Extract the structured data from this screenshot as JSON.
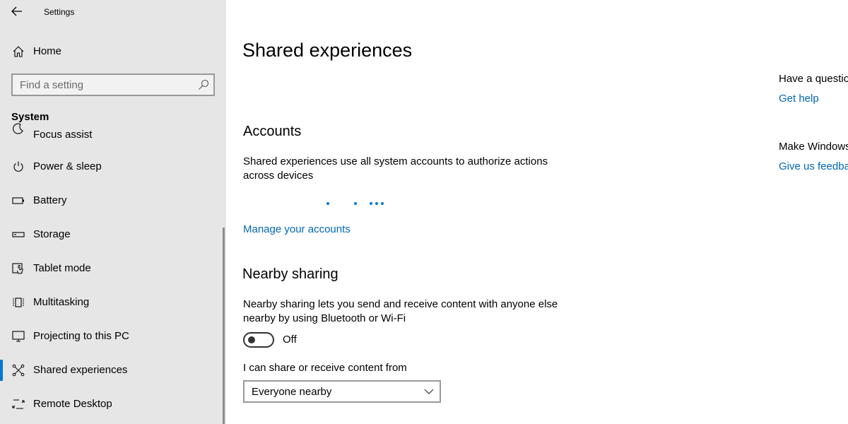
{
  "window": {
    "title": "Settings"
  },
  "sidebar": {
    "home_label": "Home",
    "search": {
      "placeholder": "Find a setting",
      "value": ""
    },
    "section_heading": "System",
    "items": [
      {
        "label": "Focus assist",
        "icon": "moon-icon"
      },
      {
        "label": "Power & sleep",
        "icon": "power-icon"
      },
      {
        "label": "Battery",
        "icon": "battery-icon"
      },
      {
        "label": "Storage",
        "icon": "storage-icon"
      },
      {
        "label": "Tablet mode",
        "icon": "tablet-mode-icon"
      },
      {
        "label": "Multitasking",
        "icon": "multitasking-icon"
      },
      {
        "label": "Projecting to this PC",
        "icon": "projecting-icon"
      },
      {
        "label": "Shared experiences",
        "icon": "shared-experiences-icon",
        "selected": true
      },
      {
        "label": "Remote Desktop",
        "icon": "remote-desktop-icon"
      }
    ]
  },
  "main": {
    "page_title": "Shared experiences",
    "accounts": {
      "heading": "Accounts",
      "description": "Shared experiences use all system accounts to authorize actions across devices",
      "link": "Manage your accounts"
    },
    "nearby_sharing": {
      "heading": "Nearby sharing",
      "description": "Nearby sharing lets you send and receive content with anyone else nearby by using Bluetooth or Wi-Fi",
      "toggle_state": "Off",
      "share_from_label": "I can share or receive content from",
      "share_from_value": "Everyone nearby"
    }
  },
  "right_panel": {
    "question_text": "Have a questio",
    "help_link": "Get help",
    "feedback_text": "Make Windows",
    "feedback_link": "Give us feedba"
  },
  "colors": {
    "accent": "#0078d7",
    "link": "#0067b8",
    "sidebar_bg": "#e6e6e6"
  }
}
